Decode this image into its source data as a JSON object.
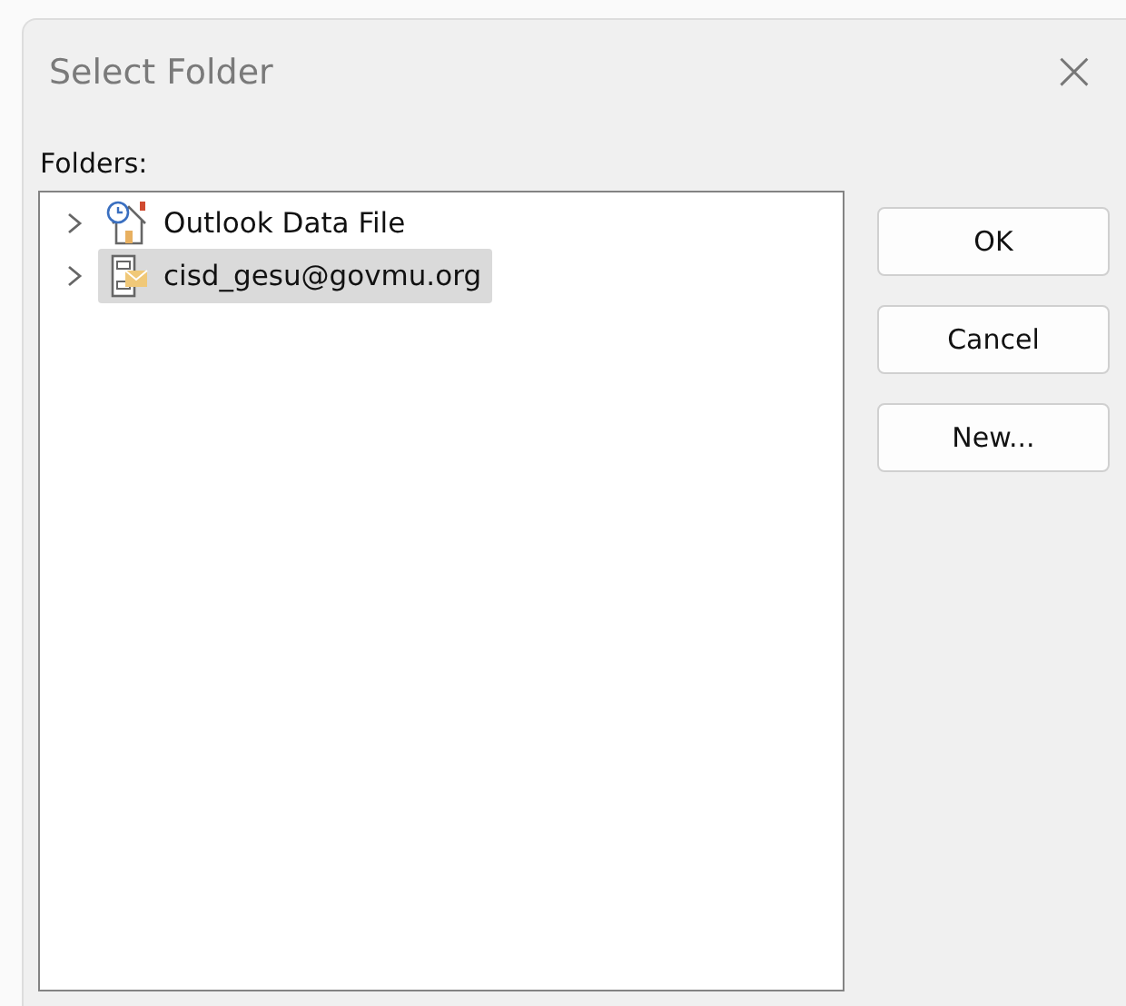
{
  "window": {
    "title": "Select Folder",
    "close": "×"
  },
  "folders_label": "Folders:",
  "tree": [
    {
      "label": "Outlook Data File",
      "kind": "datafile",
      "expanded": false,
      "selected": false
    },
    {
      "label": "cisd_gesu@govmu.org",
      "kind": "mailbox",
      "expanded": false,
      "selected": true
    }
  ],
  "buttons": [
    "OK",
    "Cancel",
    "New..."
  ]
}
